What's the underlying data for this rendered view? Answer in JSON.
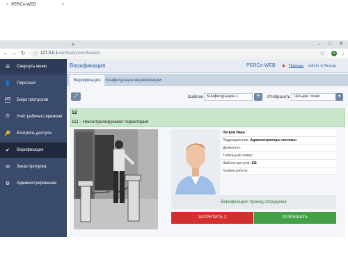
{
  "browser": {
    "tab_title": "PERCo-WEB",
    "tab_close": "×",
    "new_tab": "+",
    "url_host": "127.0.0.1",
    "url_path": "/verification/verification",
    "profile_letter": "A"
  },
  "sidebar": {
    "items": [
      {
        "label": "Свернуть меню",
        "icon": "☰"
      },
      {
        "label": "Персонал",
        "icon": "👤"
      },
      {
        "label": "Бюро пропусков",
        "icon": "🗂"
      },
      {
        "label": "Учёт рабочего времени",
        "icon": "⏱"
      },
      {
        "label": "Контроль доступа",
        "icon": "🔑"
      },
      {
        "label": "Верификация",
        "icon": "✔"
      },
      {
        "label": "Заказ пропуска",
        "icon": "✉"
      },
      {
        "label": "Администрирование",
        "icon": "⚙"
      }
    ],
    "active_index": 5
  },
  "header": {
    "title": "Верификация",
    "brand": "PERCo-WEB",
    "help": "Помощь",
    "user": "admin",
    "logout": "Выход"
  },
  "tabs": [
    {
      "label": "Верификация"
    },
    {
      "label": "Конфигурация верификации"
    }
  ],
  "toolbar": {
    "template_label": "Шаблон",
    "template_value": "Конфигурация 1",
    "display_label": "Отобразить",
    "display_value": "Четыре точки"
  },
  "zone": {
    "number": "12",
    "name": "111 - Неконтролируемая территория"
  },
  "employee": {
    "name": "Петров Иван",
    "department_label": "Подразделение:",
    "department_value": "Администраторы системы",
    "position_label": "Должность:",
    "tab_number_label": "Табельный номер:",
    "access_template_label": "Шаблон доступа:",
    "access_template_value": "111",
    "schedule_label": "График работы:"
  },
  "verification": {
    "status": "Верификация: проход сотрудника",
    "deny_label": "ЗАПРЕТИТЬ 2",
    "allow_label": "РАЗРЕШИТЬ"
  },
  "colors": {
    "sidebar": "#3a4a6b",
    "sidebar_active": "#20283b",
    "zone_bg": "#c8e6c9",
    "deny": "#d32f2f",
    "allow": "#43a047"
  }
}
